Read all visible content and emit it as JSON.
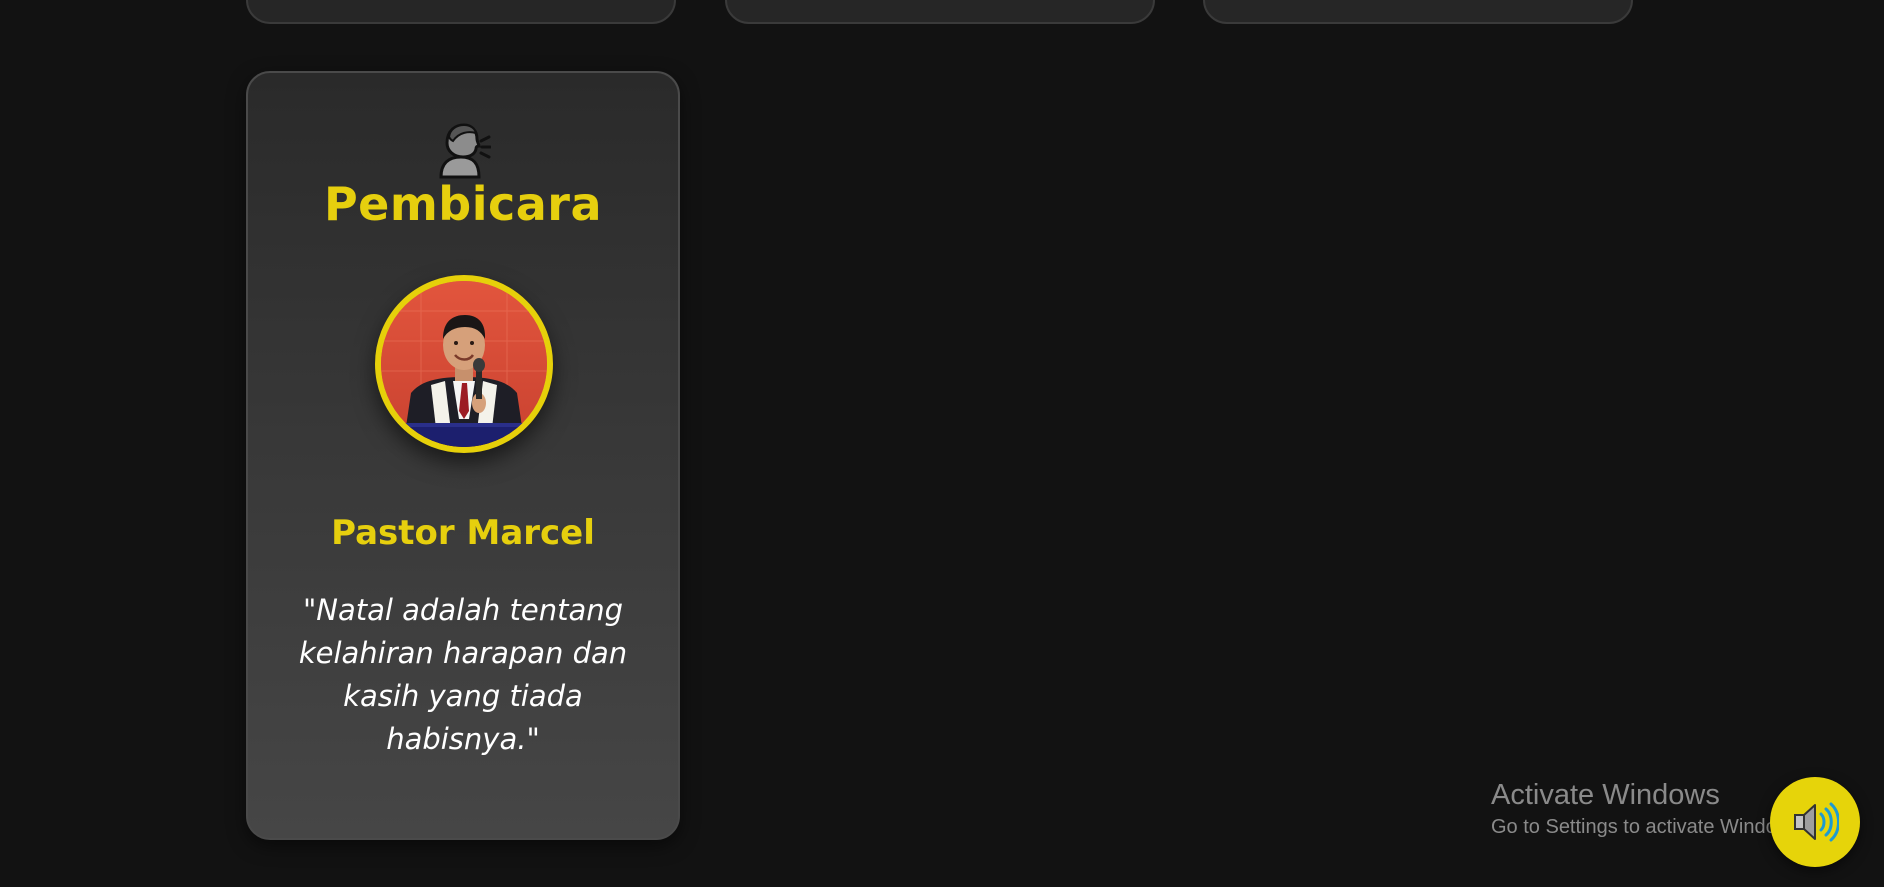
{
  "speaker_section": {
    "title": "Pembicara",
    "icon": "speaking-head-icon",
    "name": "Pastor Marcel",
    "quote": "\"Natal adalah tentang kelahiran harapan dan kasih yang tiada habisnya.\"",
    "accent_color": "#e6cf0e"
  },
  "watermark": {
    "title": "Activate Windows",
    "subtitle": "Go to Settings to activate Windows."
  },
  "music_button": {
    "icon": "speaker-volume-icon",
    "color": "#e6d40a"
  }
}
